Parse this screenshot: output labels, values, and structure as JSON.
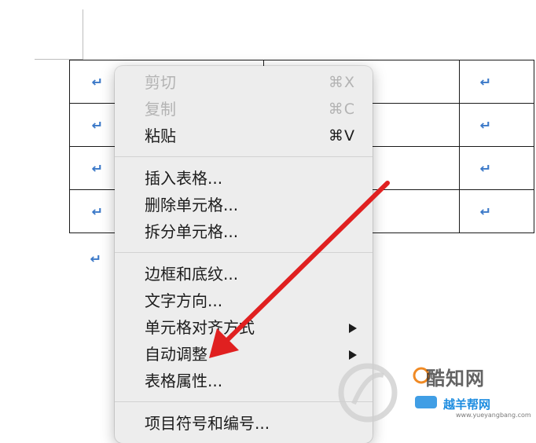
{
  "document": {
    "paragraph_mark": "↵"
  },
  "context_menu": {
    "groups": [
      [
        {
          "label": "剪切",
          "shortcut": "⌘X",
          "disabled": true
        },
        {
          "label": "复制",
          "shortcut": "⌘C",
          "disabled": true
        },
        {
          "label": "粘贴",
          "shortcut": "⌘V",
          "disabled": false
        }
      ],
      [
        {
          "label": "插入表格..."
        },
        {
          "label": "删除单元格..."
        },
        {
          "label": "拆分单元格..."
        }
      ],
      [
        {
          "label": "边框和底纹..."
        },
        {
          "label": "文字方向..."
        },
        {
          "label": "单元格对齐方式",
          "submenu": true
        },
        {
          "label": "自动调整",
          "submenu": true
        },
        {
          "label": "表格属性..."
        }
      ],
      [
        {
          "label": "项目符号和编号..."
        }
      ]
    ]
  },
  "annotation": {
    "type": "arrow",
    "color": "#e02020",
    "points_to": "表格属性..."
  },
  "watermark": {
    "text": "酷知网",
    "subtext": "越羊帮网",
    "url": "www.yueyangbang.com"
  },
  "colors": {
    "menu_background": "#ededed",
    "paragraph_mark": "#3a78c8",
    "disabled_text": "#b3b3b3"
  }
}
